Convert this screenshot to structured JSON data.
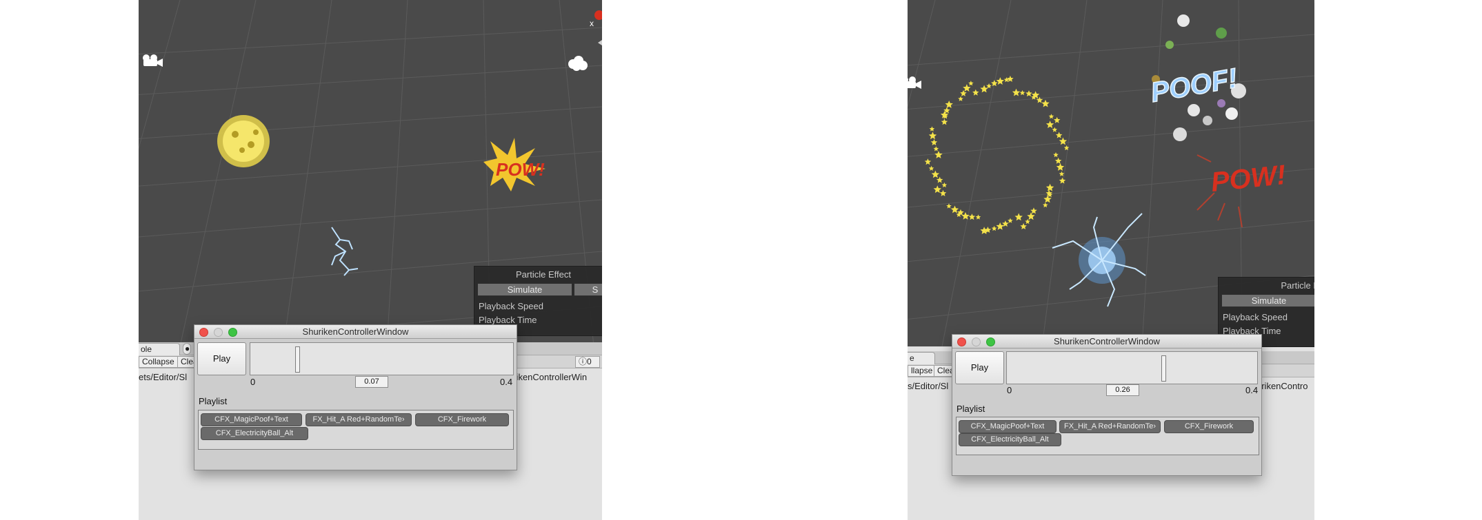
{
  "left_panel": {
    "console_tab": "ole",
    "console_buttons": [
      "Collapse",
      "Clea"
    ],
    "console_counter": "0",
    "path_text": "ets/Editor/Sl",
    "behind_window_text": "urikenControllerWin",
    "gizmo_axis_label": "x",
    "pow_text": "POW!",
    "particle_effect": {
      "title": "Particle Effect",
      "simulate_label": "Simulate",
      "stop_label": "S",
      "playback_speed_label": "Playback Speed",
      "playback_time_label": "Playback Time"
    },
    "window": {
      "title": "ShurikenControllerWindow",
      "play_label": "Play",
      "timeline_min": "0",
      "timeline_max": "0.4",
      "time_value": "0.07",
      "playhead_fraction": 0.175,
      "playlist_label": "Playlist",
      "playlist_items": [
        "CFX_MagicPoof+Text",
        "FX_Hit_A Red+RandomTe›",
        "CFX_Firework",
        "CFX_ElectricityBall_Alt"
      ]
    }
  },
  "right_panel": {
    "console_tab": "e",
    "console_buttons": [
      "llapse",
      "Clea"
    ],
    "path_text": "s/Editor/Sl",
    "behind_window_text": "urikenContro",
    "poof_text": "POOF!",
    "pow_text": "POW!",
    "particle_effect": {
      "title": "Particle Ef",
      "simulate_label": "Simulate",
      "playback_speed_label": "Playback Speed",
      "playback_time_label": "Playback Time"
    },
    "window": {
      "title": "ShurikenControllerWindow",
      "play_label": "Play",
      "timeline_min": "0",
      "timeline_max": "0.4",
      "time_value": "0.26",
      "playhead_fraction": 0.63,
      "playlist_label": "Playlist",
      "playlist_items": [
        "CFX_MagicPoof+Text",
        "FX_Hit_A Red+RandomTe›",
        "CFX_Firework",
        "CFX_ElectricityBall_Alt"
      ]
    }
  },
  "colors": {
    "scene_background": "#4a4a4a",
    "grid_line": "#5a5a5a",
    "star_yellow": "#f4e24a",
    "pow_red": "#d8301f",
    "electric_blue": "#9fd3ff",
    "traffic_red": "#f0524c",
    "traffic_green": "#3ec444"
  },
  "icons": [
    "camera-icon",
    "cloud-icon",
    "close-icon",
    "minimize-icon",
    "zoom-icon",
    "info-icon"
  ]
}
